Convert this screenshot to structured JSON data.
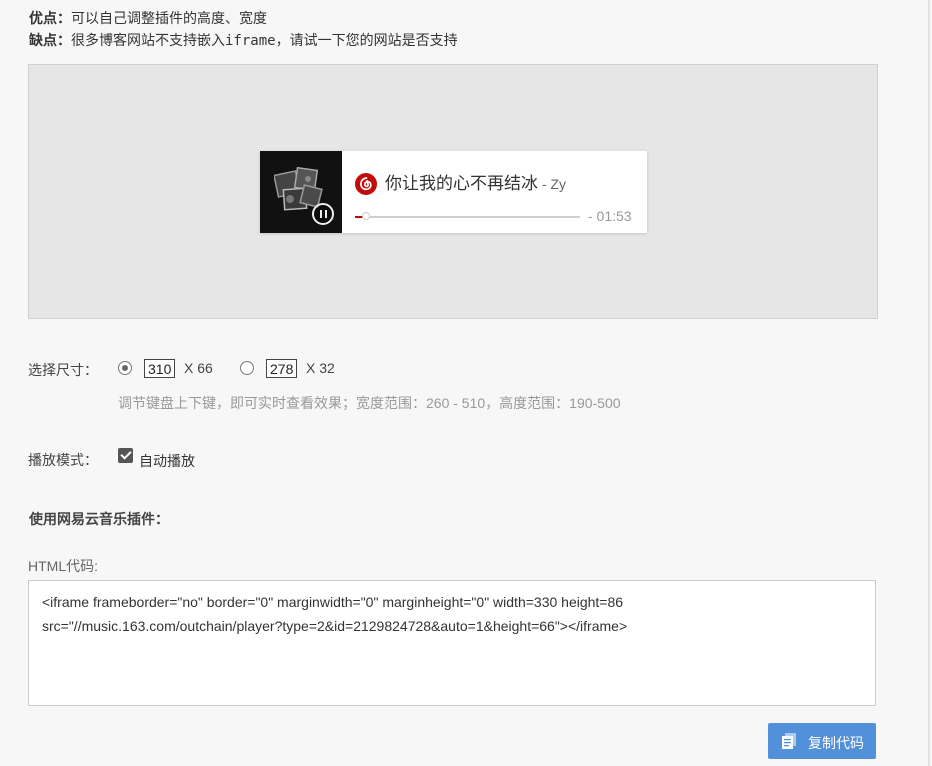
{
  "notes": {
    "pros_label": "优点：",
    "pros_text": "可以自己调整插件的高度、宽度",
    "cons_label": "缺点：",
    "cons_text": "很多博客网站不支持嵌入iframe，请试一下您的网站是否支持"
  },
  "player": {
    "song": "你让我的心不再结冰",
    "artist": " - Zy",
    "time": "- 01:53",
    "progress": 0.05,
    "accent_color": "#c20c0c",
    "logo_icon": "netease-music-icon",
    "cover_icon": "album-cover-photos"
  },
  "size": {
    "label": "选择尺寸：",
    "options": [
      {
        "width": "310",
        "x_label": "X 66",
        "selected": true
      },
      {
        "width": "278",
        "x_label": "X 32",
        "selected": false
      }
    ],
    "hint": "调节键盘上下键，即可实时查看效果；宽度范围：260 - 510，高度范围：190-500"
  },
  "mode": {
    "label": "播放模式：",
    "autoplay_label": "自动播放",
    "autoplay_checked": true
  },
  "plugin": {
    "title": "使用网易云音乐插件：",
    "html_label": "HTML代码:",
    "code_line1": "<iframe frameborder=\"no\" border=\"0\" marginwidth=\"0\" marginheight=\"0\" width=330 height=86",
    "code_line2": "src=\"//music.163.com/outchain/player?type=2&id=2129824728&auto=1&height=66\"></iframe>"
  },
  "copy_button": {
    "label": "复制代码",
    "color": "#5290d9"
  }
}
